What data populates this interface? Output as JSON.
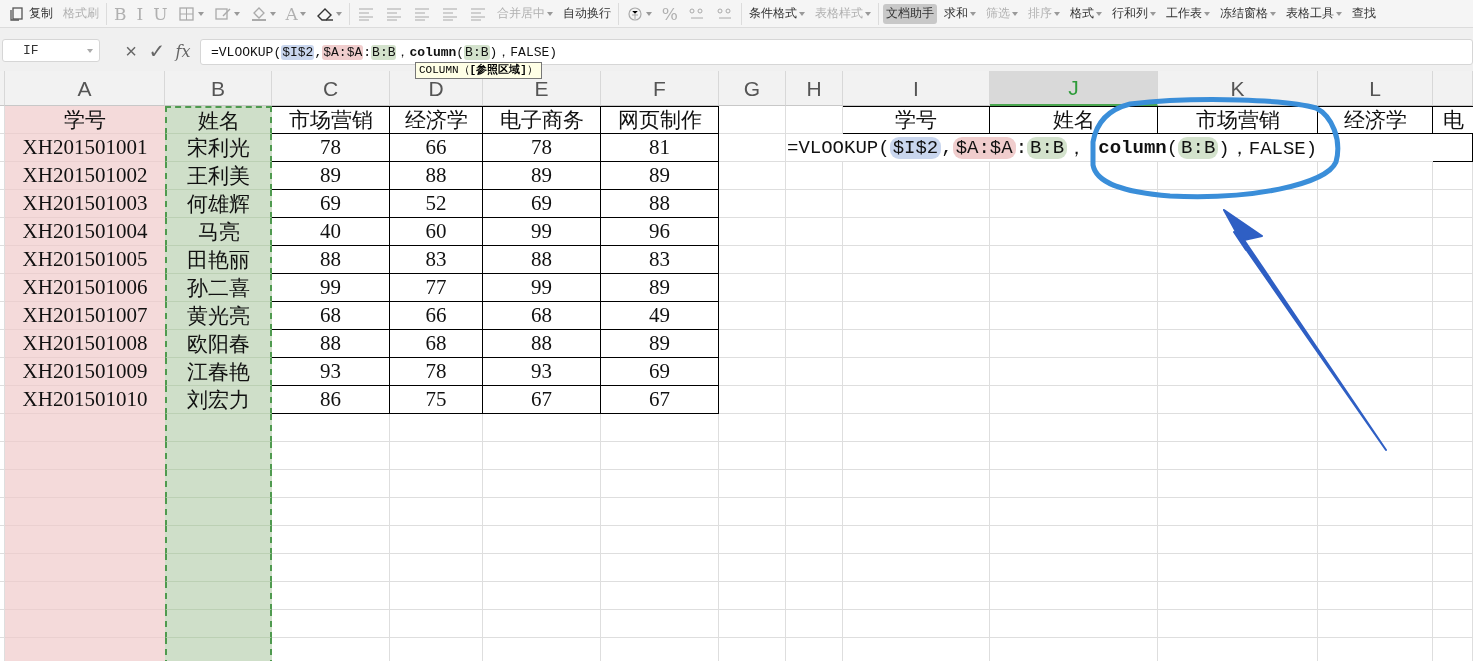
{
  "toolbar": {
    "items": [
      {
        "kind": "copy",
        "label": "复制",
        "disabled": false
      },
      {
        "kind": "text",
        "label": "格式刷",
        "disabled": true,
        "dropdown": false,
        "selected": false
      },
      {
        "kind": "sep"
      },
      {
        "kind": "glyph",
        "label": "B",
        "disabled": true
      },
      {
        "kind": "glyph",
        "label": "I",
        "disabled": true
      },
      {
        "kind": "glyph",
        "label": "U",
        "disabled": true
      },
      {
        "kind": "border",
        "disabled": true,
        "dropdown": true
      },
      {
        "kind": "shape",
        "disabled": true,
        "dropdown": true
      },
      {
        "kind": "bucket",
        "disabled": true,
        "dropdown": true
      },
      {
        "kind": "glyph",
        "label": "A",
        "disabled": true,
        "dropdown": true
      },
      {
        "kind": "eraser",
        "disabled": false,
        "dropdown": true
      },
      {
        "kind": "sep"
      },
      {
        "kind": "align",
        "disabled": true
      },
      {
        "kind": "align",
        "disabled": true
      },
      {
        "kind": "align",
        "disabled": true
      },
      {
        "kind": "align",
        "disabled": true
      },
      {
        "kind": "align",
        "disabled": true
      },
      {
        "kind": "text",
        "label": "合并居中",
        "disabled": true,
        "dropdown": true,
        "selected": false
      },
      {
        "kind": "text",
        "label": "自动换行",
        "disabled": false,
        "dropdown": false,
        "selected": false
      },
      {
        "kind": "sep"
      },
      {
        "kind": "currency",
        "disabled": true,
        "dropdown": true
      },
      {
        "kind": "glyph",
        "label": "%",
        "disabled": true
      },
      {
        "kind": "decimal",
        "disabled": true
      },
      {
        "kind": "decimal",
        "disabled": true
      },
      {
        "kind": "sep"
      },
      {
        "kind": "text",
        "label": "条件格式",
        "disabled": false,
        "dropdown": true,
        "selected": false
      },
      {
        "kind": "text",
        "label": "表格样式",
        "disabled": true,
        "dropdown": true,
        "selected": false
      },
      {
        "kind": "sep"
      },
      {
        "kind": "text",
        "label": "文档助手",
        "disabled": false,
        "dropdown": false,
        "selected": true
      },
      {
        "kind": "text",
        "label": "求和",
        "disabled": false,
        "dropdown": true,
        "selected": false
      },
      {
        "kind": "text",
        "label": "筛选",
        "disabled": true,
        "dropdown": true,
        "selected": false
      },
      {
        "kind": "text",
        "label": "排序",
        "disabled": true,
        "dropdown": true,
        "selected": false
      },
      {
        "kind": "text",
        "label": "格式",
        "disabled": false,
        "dropdown": true,
        "selected": false
      },
      {
        "kind": "text",
        "label": "行和列",
        "disabled": false,
        "dropdown": true,
        "selected": false
      },
      {
        "kind": "text",
        "label": "工作表",
        "disabled": false,
        "dropdown": true,
        "selected": false
      },
      {
        "kind": "text",
        "label": "冻结窗格",
        "disabled": false,
        "dropdown": true,
        "selected": false
      },
      {
        "kind": "text",
        "label": "表格工具",
        "disabled": false,
        "dropdown": true,
        "selected": false
      },
      {
        "kind": "text",
        "label": "查找",
        "disabled": false,
        "dropdown": false,
        "selected": false
      }
    ]
  },
  "formula_bar": {
    "name_box": "IF",
    "cancel": "×",
    "confirm": "✓",
    "fx": "fx",
    "segments": [
      {
        "kind": "text",
        "text": "=VLOOKUP("
      },
      {
        "kind": "ref",
        "text": "$I$2",
        "color": "#c9d6ee"
      },
      {
        "kind": "text",
        "text": ","
      },
      {
        "kind": "ref",
        "text": "$A:$A",
        "color": "#f0cdcd"
      },
      {
        "kind": "text",
        "text": ":"
      },
      {
        "kind": "ref",
        "text": "B:B",
        "color": "#d3e2cc"
      },
      {
        "kind": "text",
        "text": "，"
      },
      {
        "kind": "func",
        "text": "column"
      },
      {
        "kind": "text",
        "text": "("
      },
      {
        "kind": "ref",
        "text": "B:B",
        "color": "#d3e2cc"
      },
      {
        "kind": "text",
        "text": ")，FALSE)"
      }
    ]
  },
  "tooltip": "COLUMN（**[参照区域]**）",
  "sheet": {
    "columns": [
      {
        "label": "A",
        "selected": false,
        "color": "#f4dada"
      },
      {
        "label": "B",
        "selected": false,
        "color": "#cfdfc9"
      },
      {
        "label": "C",
        "selected": false
      },
      {
        "label": "D",
        "selected": false
      },
      {
        "label": "E",
        "selected": false
      },
      {
        "label": "F",
        "selected": false
      },
      {
        "label": "G",
        "selected": false
      },
      {
        "label": "H",
        "selected": false
      },
      {
        "label": "I",
        "selected": false
      },
      {
        "label": "J",
        "selected": true
      },
      {
        "label": "K",
        "selected": false
      },
      {
        "label": "L",
        "selected": false
      }
    ],
    "table": {
      "header": [
        "学号",
        "姓名",
        "市场营销",
        "经济学",
        "电子商务",
        "网页制作"
      ],
      "rows": [
        [
          "XH201501001",
          "宋利光",
          "78",
          "66",
          "78",
          "81"
        ],
        [
          "XH201501002",
          "王利美",
          "89",
          "88",
          "89",
          "89"
        ],
        [
          "XH201501003",
          "何雄辉",
          "69",
          "52",
          "69",
          "88"
        ],
        [
          "XH201501004",
          "马亮",
          "40",
          "60",
          "99",
          "96"
        ],
        [
          "XH201501005",
          "田艳丽",
          "88",
          "83",
          "88",
          "83"
        ],
        [
          "XH201501006",
          "孙二喜",
          "99",
          "77",
          "99",
          "89"
        ],
        [
          "XH201501007",
          "黄光亮",
          "68",
          "66",
          "68",
          "49"
        ],
        [
          "XH201501008",
          "欧阳春",
          "88",
          "68",
          "88",
          "89"
        ],
        [
          "XH201501009",
          "江春艳",
          "93",
          "78",
          "93",
          "69"
        ],
        [
          "XH201501010",
          "刘宏力",
          "86",
          "75",
          "67",
          "67"
        ]
      ]
    },
    "lookup": {
      "header": [
        "学号",
        "姓名",
        "市场营销",
        "经济学",
        "电"
      ],
      "formula": [
        {
          "kind": "text",
          "text": "=VLOOKUP("
        },
        {
          "kind": "ref",
          "text": "$I$2",
          "color": "#c9d6ee"
        },
        {
          "kind": "text",
          "text": ","
        },
        {
          "kind": "ref",
          "text": "$A:$A",
          "color": "#f0cdcd"
        },
        {
          "kind": "text",
          "text": ":"
        },
        {
          "kind": "ref",
          "text": "B:B",
          "color": "#d3e2cc"
        },
        {
          "kind": "text",
          "text": "，"
        },
        {
          "kind": "func",
          "text": "column"
        },
        {
          "kind": "text",
          "text": "("
        },
        {
          "kind": "ref",
          "text": "B:B",
          "color": "#d3e2cc"
        },
        {
          "kind": "text",
          "text": ")，FALSE)"
        }
      ]
    }
  }
}
